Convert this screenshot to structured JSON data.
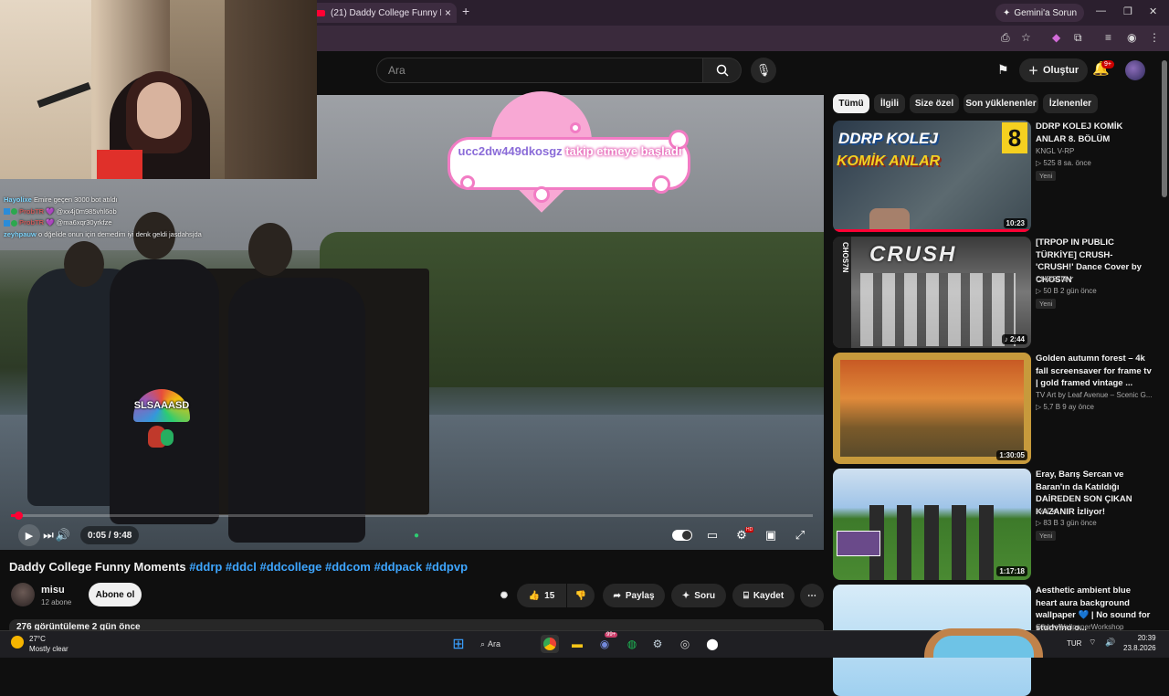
{
  "browser": {
    "tab_title": "(21) Daddy College Funny M...",
    "new_tab": "+",
    "gemini_label": "Gemini'a Sorun"
  },
  "youtube": {
    "search_placeholder": "Ara",
    "create_label": "Oluştur",
    "notifications_badge": "9+"
  },
  "stream_overlay": {
    "chat": [
      {
        "user": "Hayolixe",
        "message": "Emire geçen 3000 bot atıldı"
      },
      {
        "user": "ProbTR",
        "message": "@xx4j0m985vhl6ob"
      },
      {
        "user": "ProbTR",
        "message": "@ma6xqr30yrkfze"
      },
      {
        "user": "zeyhpauw",
        "message": "o dğelide onun için demedim iyi denk geldi jasdahsjda"
      }
    ],
    "alert_user": "ucc2dw449dkosgz",
    "alert_text": "takip etmeye başladı",
    "emote_label": "SLSAAASD"
  },
  "player": {
    "progress": 0.009,
    "time": "0:05 / 9:48"
  },
  "video": {
    "title_main": "Daddy College Funny Moments",
    "title_tags": "#ddrp #ddcl #ddcollege #ddcom #ddpack #ddpvp",
    "channel_name": "misu",
    "subscribers": "12 abone",
    "subscribe_label": "Abone ol",
    "likes": "15",
    "share_label": "Paylaş",
    "ask_label": "Soru",
    "save_label": "Kaydet",
    "views_text": "276 görüntüleme 2 gün önce"
  },
  "sidebar": {
    "chips": [
      "Tümü",
      "İlgili",
      "Size özel",
      "Son yüklenenler",
      "İzlenenler"
    ],
    "recommendations": [
      {
        "title": "DDRP KOLEJ KOMİK ANLAR 8. BÖLÜM",
        "channel": "KNGL V-RP",
        "meta": "525  8 sa. önce",
        "badge": "Yeni",
        "duration": "10:23",
        "thumb_text_1": "DDRP KOLEJ",
        "thumb_text_2": "KOMİK ANLAR",
        "thumb_num": "8"
      },
      {
        "title": "[TRPOP IN PUBLIC TÜRKİYE] CRUSH- 'CRUSH!' Dance Cover by CHOS7N",
        "channel": "CHOS7N",
        "meta": "50 B  2 gün önce",
        "badge": "Yeni",
        "duration": "2:44",
        "thumb_text_1": "CRUSH",
        "thumb_side": "CHOS7N"
      },
      {
        "title": "Golden autumn forest – 4k fall screensaver for frame tv | gold framed vintage ...",
        "channel": "TV Art by Leaf Avenue – Scenic G...",
        "meta": "5,7 B  9 ay önce",
        "duration": "1:30:05"
      },
      {
        "title": "Eray, Barış Sercan ve Baran'ın da Katıldığı DAİREDEN SON ÇIKAN KAZANIR İzliyor!",
        "channel": "axel",
        "meta": "83 B  3 gün önce",
        "badge": "Yeni",
        "duration": "1:17:18"
      },
      {
        "title": "Aesthetic ambient blue heart aura background wallpaper 💙 | No sound for studying o...",
        "channel": "GibbysWallpaperWorkshop"
      }
    ]
  },
  "taskbar": {
    "temp": "27°C",
    "weather": "Mostly clear",
    "search_label": "Ara",
    "lang": "TUR",
    "time": "20:39",
    "date": "23.8.2026",
    "badge": "99+"
  },
  "colors": {
    "accent": "#ff0033",
    "link": "#3ea6ff",
    "alert_pink": "#f27cc4"
  }
}
